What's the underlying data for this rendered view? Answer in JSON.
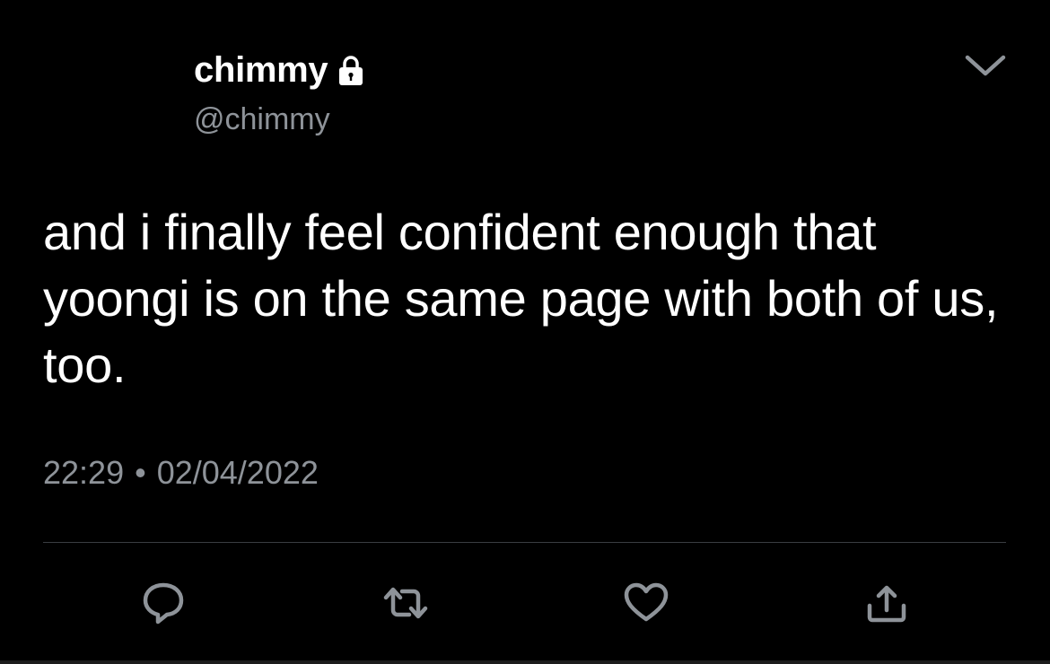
{
  "tweet": {
    "display_name": "chimmy",
    "handle": "@chimmy",
    "text": "and i finally feel confident enough that yoongi is on the same page with both of us, too.",
    "time": "22:29",
    "separator": "•",
    "date": "02/04/2022"
  },
  "icons": {
    "protected": "lock-icon",
    "menu": "chevron-down-icon",
    "reply": "speech-bubble-icon",
    "retweet": "retweet-arrows-icon",
    "like": "heart-icon",
    "share": "share-upload-icon"
  },
  "colors": {
    "background": "#000000",
    "primary_text": "#ffffff",
    "secondary_text": "#8e9399",
    "divider": "#3a3d41"
  }
}
